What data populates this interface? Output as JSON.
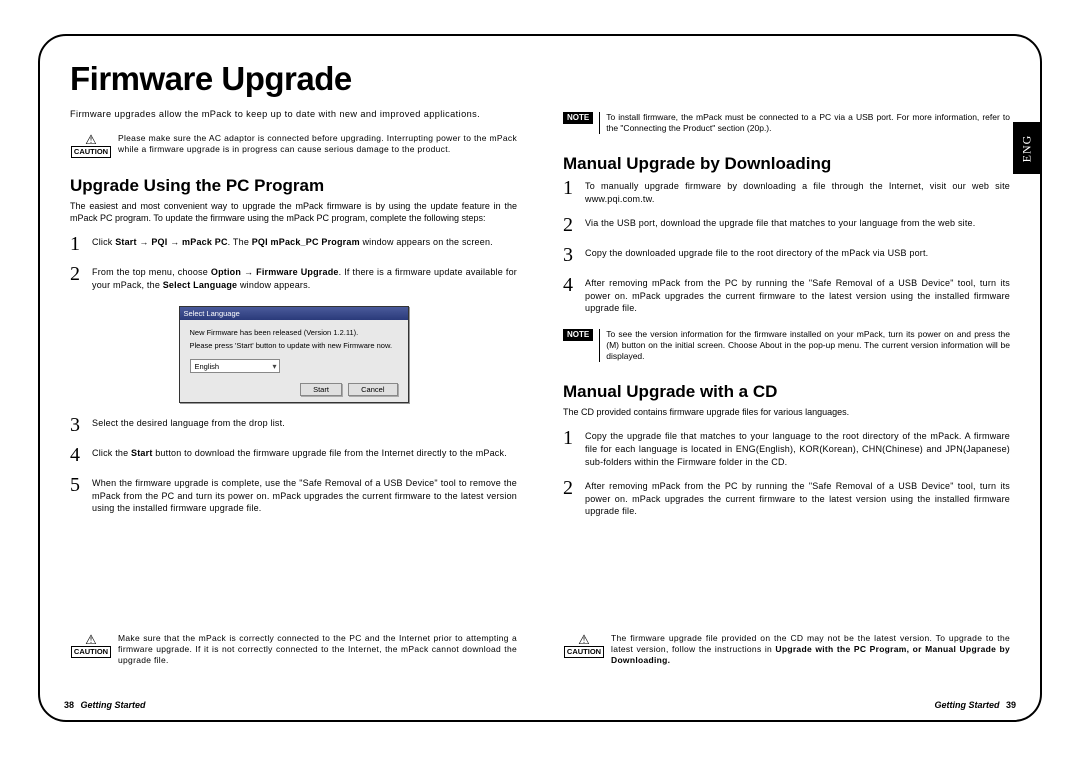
{
  "title": "Firmware Upgrade",
  "lang_tab": "ENG",
  "left": {
    "intro": "Firmware upgrades allow the mPack to keep up to date with new and improved applications.",
    "caution1": "Please make sure the AC adaptor is connected before upgrading. Interrupting power to the mPack while a firmware upgrade is in progress can cause serious damage to the product.",
    "section_title": "Upgrade Using the PC Program",
    "section_intro": "The easiest and most convenient way to upgrade the mPack firmware is by using the update feature in the mPack PC program. To update the firmware using the mPack PC program, complete the following steps:",
    "step1_pre": "Click ",
    "step1_bold1": "Start",
    "step1_mid1": " → ",
    "step1_bold2": "PQI",
    "step1_mid2": " → ",
    "step1_bold3": "mPack PC",
    "step1_mid3": ". The ",
    "step1_bold4": "PQI mPack_PC Program",
    "step1_post": " window appears on the screen.",
    "step2_pre": "From the top menu, choose ",
    "step2_bold1": "Option",
    "step2_mid1": " → ",
    "step2_bold2": "Firmware Upgrade",
    "step2_mid2": ". If there is a firmware update available for your mPack, the ",
    "step2_bold3": "Select Language",
    "step2_post": " window appears.",
    "step3": "Select the desired language from the drop list.",
    "step4_pre": "Click the ",
    "step4_bold": "Start",
    "step4_post": " button to download the firmware upgrade file from the Internet directly to the mPack.",
    "step5": "When the firmware upgrade is complete, use the \"Safe Removal of a USB Device\" tool to remove the mPack from the PC and turn its power on. mPack upgrades the current firmware to the latest version using the installed firmware upgrade file.",
    "caution2": "Make sure that the mPack is correctly connected to the PC and the Internet prior to attempting a firmware upgrade. If it is not correctly connected to the Internet, the mPack cannot download the upgrade file."
  },
  "right": {
    "note1": "To install firmware, the mPack must be connected to a PC via a USB port. For more information, refer to the \"Connecting the Product\" section (20p.).",
    "section1_title": "Manual Upgrade by Downloading",
    "s1_step1": "To manually upgrade firmware by downloading a file through the Internet, visit our web site www.pqi.com.tw.",
    "s1_step2": "Via the USB port, download the upgrade file that matches to your language from the web site.",
    "s1_step3": "Copy the downloaded upgrade file to the root directory of the mPack via USB port.",
    "s1_step4": "After removing mPack from the PC by running the \"Safe Removal of a USB Device\" tool, turn its power on. mPack upgrades the current firmware to the latest version using the installed firmware upgrade file.",
    "note2": "To see the version information for the firmware installed on your mPack, turn its power on and press the (M) button on the initial screen. Choose About in the pop-up menu. The current version information will be displayed.",
    "section2_title": "Manual Upgrade with a CD",
    "section2_intro": "The CD provided contains firmware upgrade files for various languages.",
    "s2_step1": "Copy the upgrade file that matches to your language to the root directory of the mPack. A firmware file for each language is located in ENG(English), KOR(Korean), CHN(Chinese) and JPN(Japanese) sub-folders within the Firmware folder in the CD.",
    "s2_step2": "After removing mPack from the PC by running the \"Safe Removal of a USB Device\" tool, turn its power on. mPack upgrades the current firmware to the latest version using the installed firmware upgrade file.",
    "caution_pre": "The firmware upgrade file provided on the CD may not be the latest version. To upgrade to the latest version, follow the instructions in ",
    "caution_bold": "Upgrade with the PC Program, or Manual Upgrade by Downloading.",
    "caution_post": ""
  },
  "dialog": {
    "title": "Select Language",
    "msg1": "New Firmware has been released (Version 1.2.11).",
    "msg2": "Please press 'Start' button to update with new Firmware now.",
    "select": "English",
    "btn_start": "Start",
    "btn_cancel": "Cancel"
  },
  "footer": {
    "left_page": "38",
    "left_label": "Getting Started",
    "right_label": "Getting Started",
    "right_page": "39"
  },
  "labels": {
    "caution": "CAUTION",
    "note": "NOTE"
  }
}
